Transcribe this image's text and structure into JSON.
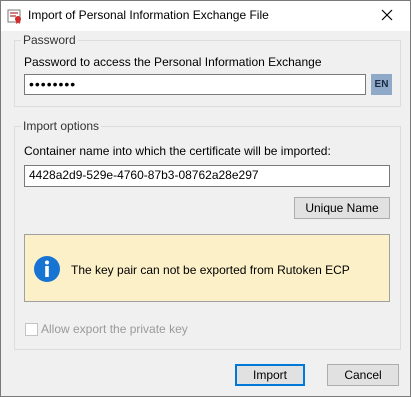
{
  "window": {
    "title": "Import of Personal Information Exchange File",
    "app_icon": "certificate-app-icon",
    "close_icon": "close-icon"
  },
  "password_group": {
    "label": "Password",
    "prompt": "Password to access the Personal Information Exchange",
    "password_value": "••••••••",
    "language_indicator": "EN"
  },
  "import_options": {
    "label": "Import options",
    "container_prompt": "Container name into which the certificate will be imported:",
    "container_value": "4428a2d9-529e-4760-87b3-08762a28e297",
    "unique_name_button": "Unique Name",
    "info_icon": "info-icon",
    "info_message": "The key pair can not be exported from Rutoken ECP",
    "allow_export_label": "Allow export the private key",
    "allow_export_checked": false,
    "allow_export_enabled": false
  },
  "buttons": {
    "import": "Import",
    "cancel": "Cancel"
  },
  "colors": {
    "dialog_bg": "#f0f0f0",
    "info_bg": "#fbf0c8",
    "info_icon_blue": "#1874d2",
    "default_button_border": "#0078d7"
  }
}
